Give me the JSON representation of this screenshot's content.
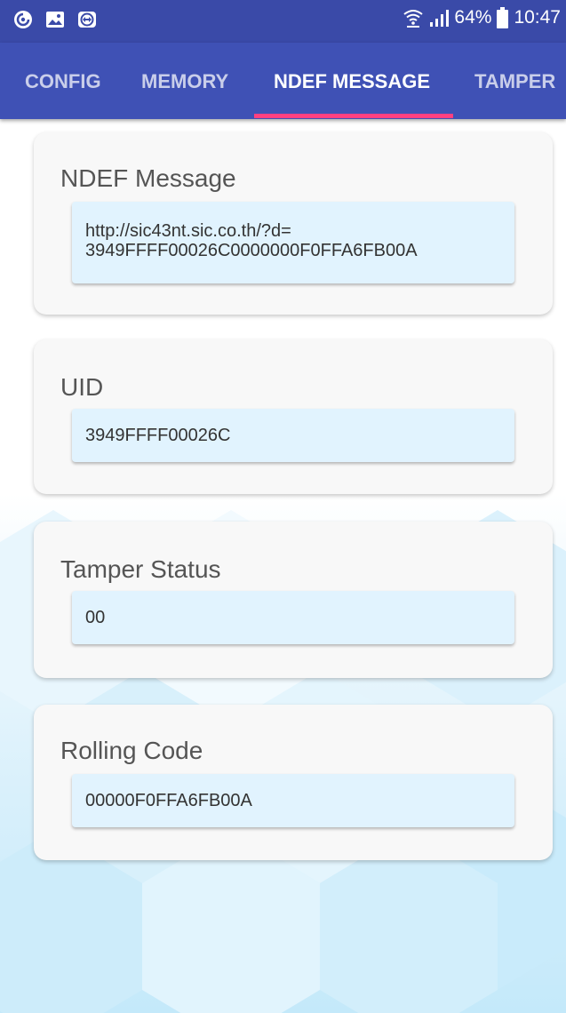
{
  "status_bar": {
    "left_icons": [
      "notification-icon",
      "image-icon",
      "transfer-icon"
    ],
    "battery": "64%",
    "time": "10:47"
  },
  "tabs": [
    {
      "label": "CONFIG",
      "active": false
    },
    {
      "label": "MEMORY",
      "active": false
    },
    {
      "label": "NDEF MESSAGE",
      "active": true
    },
    {
      "label": "TAMPER",
      "active": false
    }
  ],
  "cards": {
    "ndef": {
      "label": "NDEF Message",
      "value": "http://sic43nt.sic.co.th/?d=\n3949FFFF00026C0000000F0FFA6FB00A"
    },
    "uid": {
      "label": "UID",
      "value": "3949FFFF00026C"
    },
    "tamper": {
      "label": "Tamper Status",
      "value": "00"
    },
    "rolling": {
      "label": "Rolling Code",
      "value": "00000F0FFA6FB00A"
    }
  },
  "colors": {
    "status_bar": "#3a4aa8",
    "toolbar": "#3f51b5",
    "tab_indicator": "#ff4081",
    "field_background": "#e1f3fe",
    "card_background": "#f8f8f8"
  }
}
